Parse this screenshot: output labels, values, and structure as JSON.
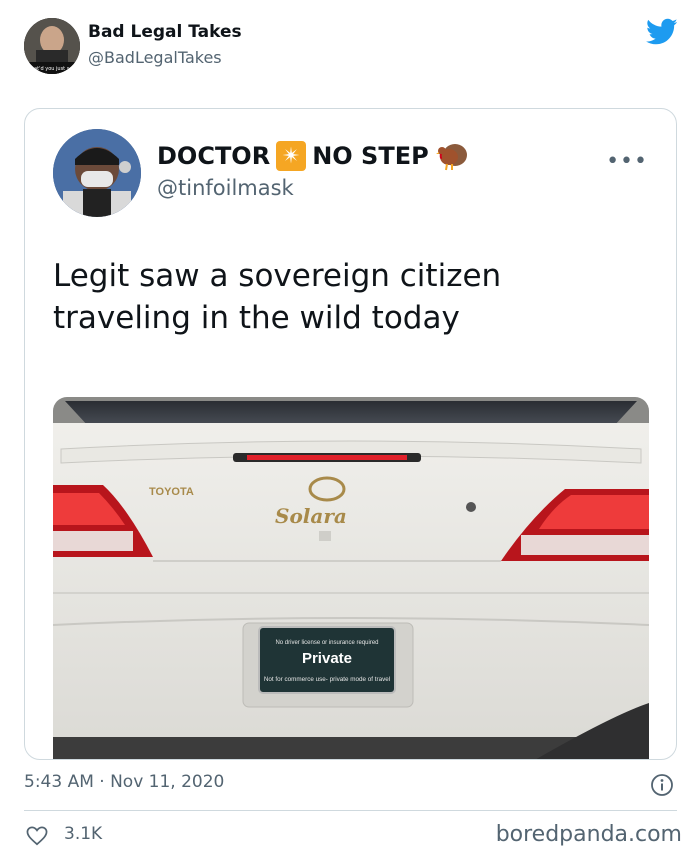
{
  "outer": {
    "name": "Bad Legal Takes",
    "handle": "@BadLegalTakes",
    "avatar_caption": "What'd you just say?"
  },
  "quoted": {
    "name_part1": "DOCTOR",
    "name_part2": "NO STEP",
    "badge_glyph": "✴",
    "handle": "@tinfoilmask",
    "more_glyph": "•••",
    "text": "Legit saw a sovereign citizen traveling in the wild today",
    "photo": {
      "car_brand": "TOYOTA",
      "car_model": "Solara",
      "plate_top": "No driver license or insurance required",
      "plate_main": "Private",
      "plate_bottom": "Not for commerce use- private mode of travel"
    }
  },
  "footer": {
    "timestamp": "5:43 AM · Nov 11, 2020",
    "likes": "3.1K",
    "watermark": "boredpanda.com"
  },
  "colors": {
    "text_primary": "#0f1419",
    "text_secondary": "#536471",
    "twitter_blue": "#1d9bf0",
    "border": "#cfd9de"
  },
  "icons": [
    "twitter-bird-icon",
    "sparkle-icon",
    "turkey-icon",
    "more-icon",
    "info-icon",
    "heart-icon"
  ]
}
